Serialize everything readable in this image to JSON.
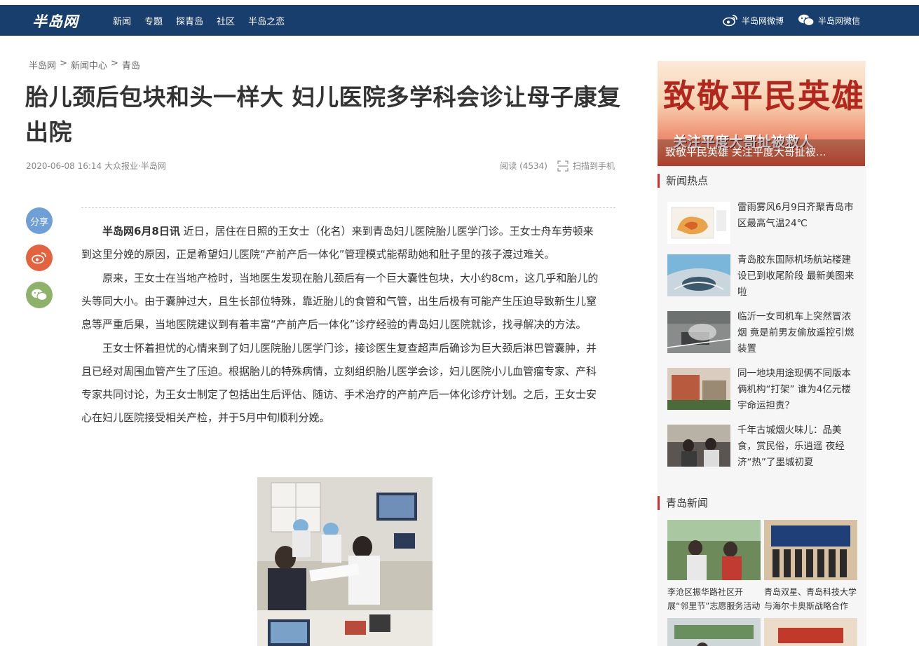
{
  "site": {
    "logo": "半岛网",
    "nav": [
      "新闻",
      "专题",
      "探青岛",
      "社区",
      "半岛之恋"
    ],
    "weibo_label": "半岛网微博",
    "wechat_label": "半岛网微信"
  },
  "breadcrumb": [
    "半岛网",
    "新闻中心",
    "青岛"
  ],
  "article": {
    "title": "胎儿颈后包块和头一样大 妇儿医院多学科会诊让母子康复出院",
    "meta": "2020-06-08 16:14 大众报业·半岛网",
    "reads": "阅读 (4534)",
    "scan": "扫描到手机",
    "lead": "半岛网6月8日讯",
    "p1": " 近日，居住在日照的王女士（化名）来到青岛妇儿医院胎儿医学门诊。王女士舟车劳顿来到这里分娩的原因，正是希望妇儿医院“产前产后一体化”管理模式能帮助她和肚子里的孩子渡过难关。",
    "p2": "原来，王女士在当地产检时，当地医生发现在胎儿颈后有一个巨大囊性包块，大小约8cm，这几乎和胎儿的头等同大小。由于囊肿过大，且生长部位特殊，靠近胎儿的食管和气管，出生后极有可能产生压迫导致新生儿窒息等严重后果，当地医院建议到有着丰富“产前产后一体化”诊疗经验的青岛妇儿医院就诊，找寻解决的方法。",
    "p3": "王女士怀着担忧的心情来到了妇儿医院胎儿医学门诊，接诊医生复查超声后确诊为巨大颈后淋巴管囊肿，并且已经对周围血管产生了压迫。根据胎儿的特殊病情，立刻组织胎儿医学会诊，妇儿医院小儿血管瘤专家、产科专家共同讨论，为王女士制定了包括出生后评估、随访、手术治疗的产前产后一体化诊疗计划。之后，王女士安心在妇儿医院接受相关产检，并于5月中旬顺利分娩。"
  },
  "share": {
    "label": "分享"
  },
  "sidebar": {
    "banner_big": "致敬平民英雄",
    "banner_sub": "关注平度大哥扯被救人",
    "banner_caption": "致敬平民英雄 关注平度大哥扯被…",
    "hot_title": "新闻热点",
    "hot": [
      "雷雨雾风6月9日齐聚青岛市区最高气温24℃",
      "青岛胶东国际机场航站楼建设已到收尾阶段 最新美图来啦",
      "临沂一女司机车上突然冒浓烟 竟是前男友偷放遥控引燃装置",
      "同一地块用途现俩不同版本 俩机构“打架” 谁为4亿元楼宇命运担责？",
      "千年古城烟火味儿：品美食，赏民俗，乐逍遥 夜经济“热”了墨城初夏"
    ],
    "qd_title": "青岛新闻",
    "qd": [
      "李沧区振华路社区开展“邻里节”志愿服务活动",
      "青岛双星、青岛科技大学与海尔卡奥斯战略合作"
    ]
  }
}
